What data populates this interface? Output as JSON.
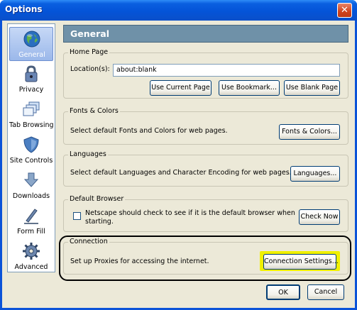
{
  "window": {
    "title": "Options",
    "close_glyph": "✕"
  },
  "sidebar": {
    "items": [
      {
        "label": "General",
        "icon": "globe-icon",
        "selected": true
      },
      {
        "label": "Privacy",
        "icon": "lock-icon"
      },
      {
        "label": "Tab Browsing",
        "icon": "tabs-icon"
      },
      {
        "label": "Site Controls",
        "icon": "shield-icon"
      },
      {
        "label": "Downloads",
        "icon": "download-arrow-icon"
      },
      {
        "label": "Form Fill",
        "icon": "pen-icon"
      },
      {
        "label": "Advanced",
        "icon": "gear-icon"
      }
    ]
  },
  "header": {
    "title": "General"
  },
  "home_page": {
    "group_title": "Home Page",
    "location_label": "Location(s):",
    "location_value": "about:blank",
    "use_current_label": "Use Current Page",
    "use_bookmark_label": "Use Bookmark...",
    "use_blank_label": "Use Blank Page"
  },
  "fonts_colors": {
    "group_title": "Fonts & Colors",
    "description": "Select default Fonts and Colors for web pages.",
    "button_label": "Fonts & Colors..."
  },
  "languages": {
    "group_title": "Languages",
    "description": "Select default Languages and Character Encoding for web pages.",
    "button_label": "Languages..."
  },
  "default_browser": {
    "group_title": "Default Browser",
    "checkbox_label_line1": "Netscape should check to see if it is the default browser when",
    "checkbox_label_line2": "starting.",
    "checked": false,
    "button_label": "Check Now"
  },
  "connection": {
    "group_title": "Connection",
    "description": "Set up Proxies for accessing the internet.",
    "button_label": "Connection Settings..."
  },
  "footer": {
    "ok_label": "OK",
    "cancel_label": "Cancel"
  },
  "colors": {
    "titlebar": "#0454d8",
    "header_bg": "#6f91a8",
    "dialog_bg": "#ece9d8",
    "highlight": "#f0f000"
  }
}
